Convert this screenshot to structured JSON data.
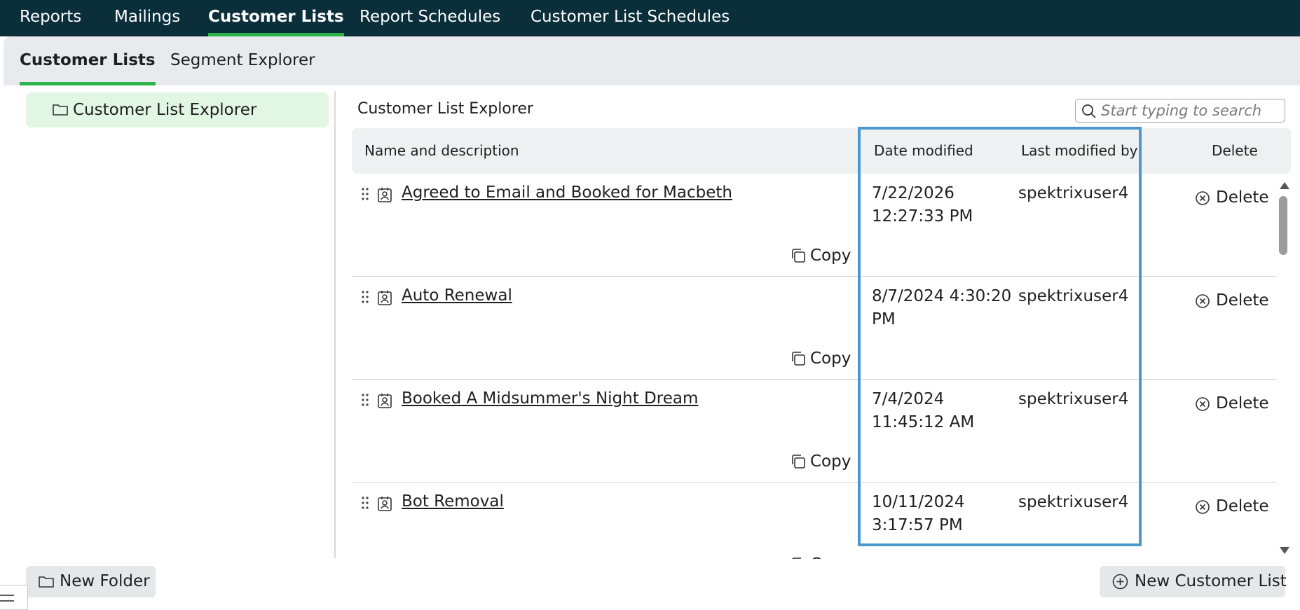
{
  "topnav": {
    "items": [
      "Reports",
      "Mailings",
      "Customer Lists",
      "Report Schedules",
      "Customer List Schedules"
    ],
    "active": "Customer Lists"
  },
  "subtabs": {
    "items": [
      "Customer Lists",
      "Segment Explorer"
    ],
    "active": "Customer Lists"
  },
  "tree": {
    "item_label": "Customer List Explorer",
    "icon": "folder-icon"
  },
  "main": {
    "title": "Customer List Explorer",
    "search_placeholder": "Start typing to search"
  },
  "table": {
    "headers": {
      "name": "Name and description",
      "date": "Date modified",
      "user": "Last modified by",
      "delete": "Delete"
    },
    "copy_label": "Copy",
    "delete_label": "Delete",
    "rows": [
      {
        "name": "Agreed to Email and Booked for Macbeth",
        "date": "7/22/2026 12:27:33 PM",
        "user": "spektrixuser4"
      },
      {
        "name": "Auto Renewal",
        "date": "8/7/2024 4:30:20 PM",
        "user": "spektrixuser4"
      },
      {
        "name": "Booked A Midsummer's Night Dream",
        "date": "7/4/2024 11:45:12 AM",
        "user": "spektrixuser4"
      },
      {
        "name": "Bot Removal",
        "date": "10/11/2024 3:17:57 PM",
        "user": "spektrixuser4"
      }
    ]
  },
  "footer": {
    "new_folder": "New Folder",
    "new_customer_list": "New Customer List"
  },
  "colors": {
    "nav_bg": "#0b2e3b",
    "accent_green": "#2bb34a",
    "highlight_blue": "#4a98cc",
    "tree_selected_bg": "#e2f6e4"
  }
}
